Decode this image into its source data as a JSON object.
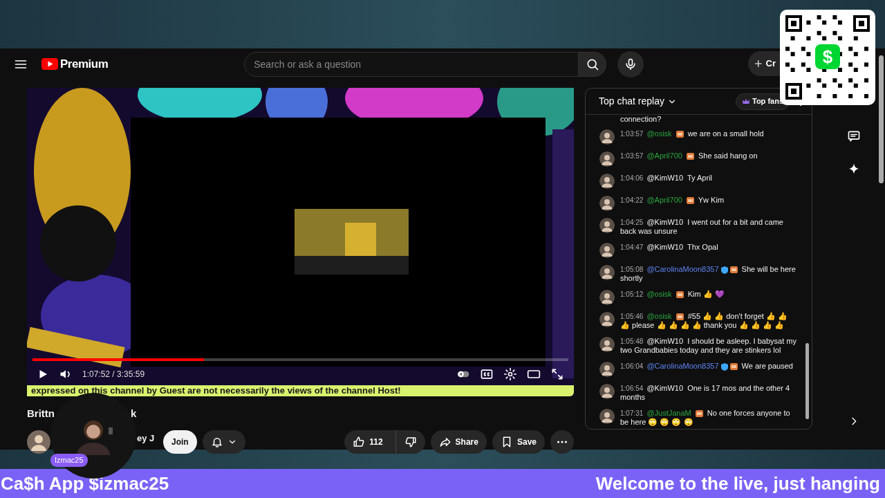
{
  "top_bar": {
    "logo_text": "Premium",
    "search": {
      "placeholder": "Search or ask a question"
    },
    "create_button": "Cr"
  },
  "qr_code": {
    "logo_glyph": "$"
  },
  "player": {
    "progress": {
      "level": 0.32
    },
    "time": "1:07:52 / 3:35:59",
    "ticker": "expressed on this channel by Guest are not necessarily the views of the channel Host!"
  },
  "video": {
    "title_parts": [
      "Brittn",
      "k"
    ],
    "channel_fragment": "ey J",
    "join_button": "Join",
    "likes": "112",
    "share_button": "Share",
    "save_button": "Save"
  },
  "webcam_overlay": {
    "label": "Izmac25"
  },
  "chat": {
    "header": "Top chat replay",
    "top_fans": "Top fans",
    "messages": [
      {
        "kind": "continuation",
        "text": "connection?"
      },
      {
        "kind": "message",
        "time": "1:03:57",
        "author": "@osisk",
        "color": "#2ba640",
        "moderator": false,
        "member_badge": true,
        "text": "we are on a small hold"
      },
      {
        "kind": "message",
        "time": "1:03:57",
        "author": "@April700",
        "color": "#2ba640",
        "moderator": false,
        "member_badge": true,
        "text": "She said hang on"
      },
      {
        "kind": "message",
        "time": "1:04:06",
        "author": "@KimW10",
        "color": "#f1f1f1",
        "moderator": false,
        "member_badge": false,
        "text": "Ty April"
      },
      {
        "kind": "message",
        "time": "1:04:22",
        "author": "@April700",
        "color": "#2ba640",
        "moderator": false,
        "member_badge": true,
        "text": "Yw Kim"
      },
      {
        "kind": "message",
        "time": "1:04:25",
        "author": "@KimW10",
        "color": "#f1f1f1",
        "moderator": false,
        "member_badge": false,
        "text": "I went out for a bit and came back was unsure"
      },
      {
        "kind": "message",
        "time": "1:04:47",
        "author": "@KimW10",
        "color": "#f1f1f1",
        "moderator": false,
        "member_badge": false,
        "text": "Thx Opal"
      },
      {
        "kind": "message",
        "time": "1:05:08",
        "author": "@CarolinaMoon8357",
        "color": "#5e84f1",
        "moderator": true,
        "member_badge": true,
        "text": "She will be here shortly"
      },
      {
        "kind": "message",
        "time": "1:05:12",
        "author": "@osisk",
        "color": "#2ba640",
        "moderator": false,
        "member_badge": true,
        "text": "Kim 👍 💜"
      },
      {
        "kind": "message",
        "time": "1:05:46",
        "author": "@osisk",
        "color": "#2ba640",
        "moderator": false,
        "member_badge": true,
        "text": "#55 👍 👍 don't forget 👍 👍 👍 please 👍 👍 👍 👍 thank you 👍 👍 👍 👍"
      },
      {
        "kind": "message",
        "time": "1:05:48",
        "author": "@KimW10",
        "color": "#f1f1f1",
        "moderator": false,
        "member_badge": false,
        "text": "I should be asleep. I babysat my two Grandbabies today and they are stinkers lol"
      },
      {
        "kind": "message",
        "time": "1:06:04",
        "author": "@CarolinaMoon8357",
        "color": "#5e84f1",
        "moderator": true,
        "member_badge": true,
        "text": "We are paused"
      },
      {
        "kind": "message",
        "time": "1:06:54",
        "author": "@KimW10",
        "color": "#f1f1f1",
        "moderator": false,
        "member_badge": false,
        "text": "One is 17 mos and the other 4 months"
      },
      {
        "kind": "message",
        "time": "1:07:31",
        "author": "@JustJanaM",
        "color": "#2ba640",
        "moderator": false,
        "member_badge": true,
        "text": "No one forces anyone to be here 🙄 🙄 🙄 🙄"
      }
    ]
  },
  "banner": {
    "left": "Ca$h App $izmac25",
    "right": "Welcome to the live, just hanging"
  }
}
